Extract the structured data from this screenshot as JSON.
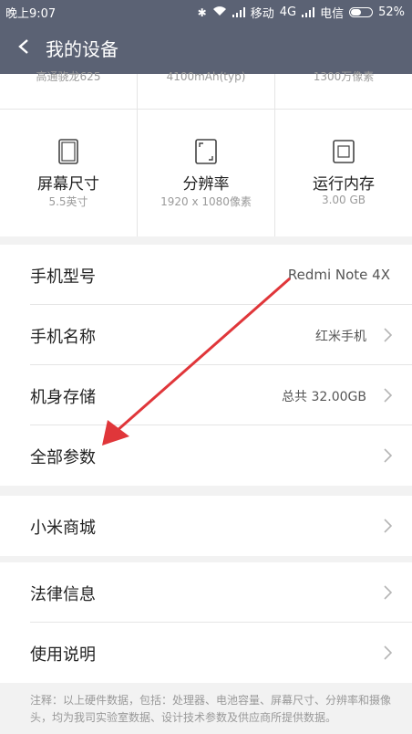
{
  "status": {
    "time": "晚上9:07",
    "carrier1": "移动",
    "network": "4G",
    "carrier2": "电信",
    "battery": "52%",
    "battery_level": 0.52
  },
  "header": {
    "title": "我的设备"
  },
  "specs": {
    "partial_top": [
      "高通骁龙625",
      "4100mAh(typ)",
      "1300万像素"
    ],
    "items": [
      {
        "icon": "screen-icon",
        "name": "屏幕尺寸",
        "caption": "5.5英寸"
      },
      {
        "icon": "resolution-icon",
        "name": "分辨率",
        "caption": "1920 x 1080像素"
      },
      {
        "icon": "memory-chip-icon",
        "name": "运行内存",
        "caption": "3.00 GB"
      }
    ]
  },
  "device_info": [
    {
      "label": "手机型号",
      "value": "Redmi Note 4X"
    },
    {
      "label": "手机名称",
      "value": "红米手机"
    },
    {
      "label": "机身存储",
      "value": "总共 32.00GB"
    },
    {
      "label": "全部参数",
      "value": ""
    }
  ],
  "store": {
    "label": "小米商城"
  },
  "legal": [
    {
      "label": "法律信息"
    },
    {
      "label": "使用说明"
    }
  ],
  "footnote": "注释：以上硬件数据，包括：处理器、电池容量、屏幕尺寸、分辨率和摄像头，均为我司实验室数据、设计技术参数及供应商所提供数据。",
  "colors": {
    "header_bg": "#5b6274",
    "annotation_arrow": "#e0363a"
  }
}
